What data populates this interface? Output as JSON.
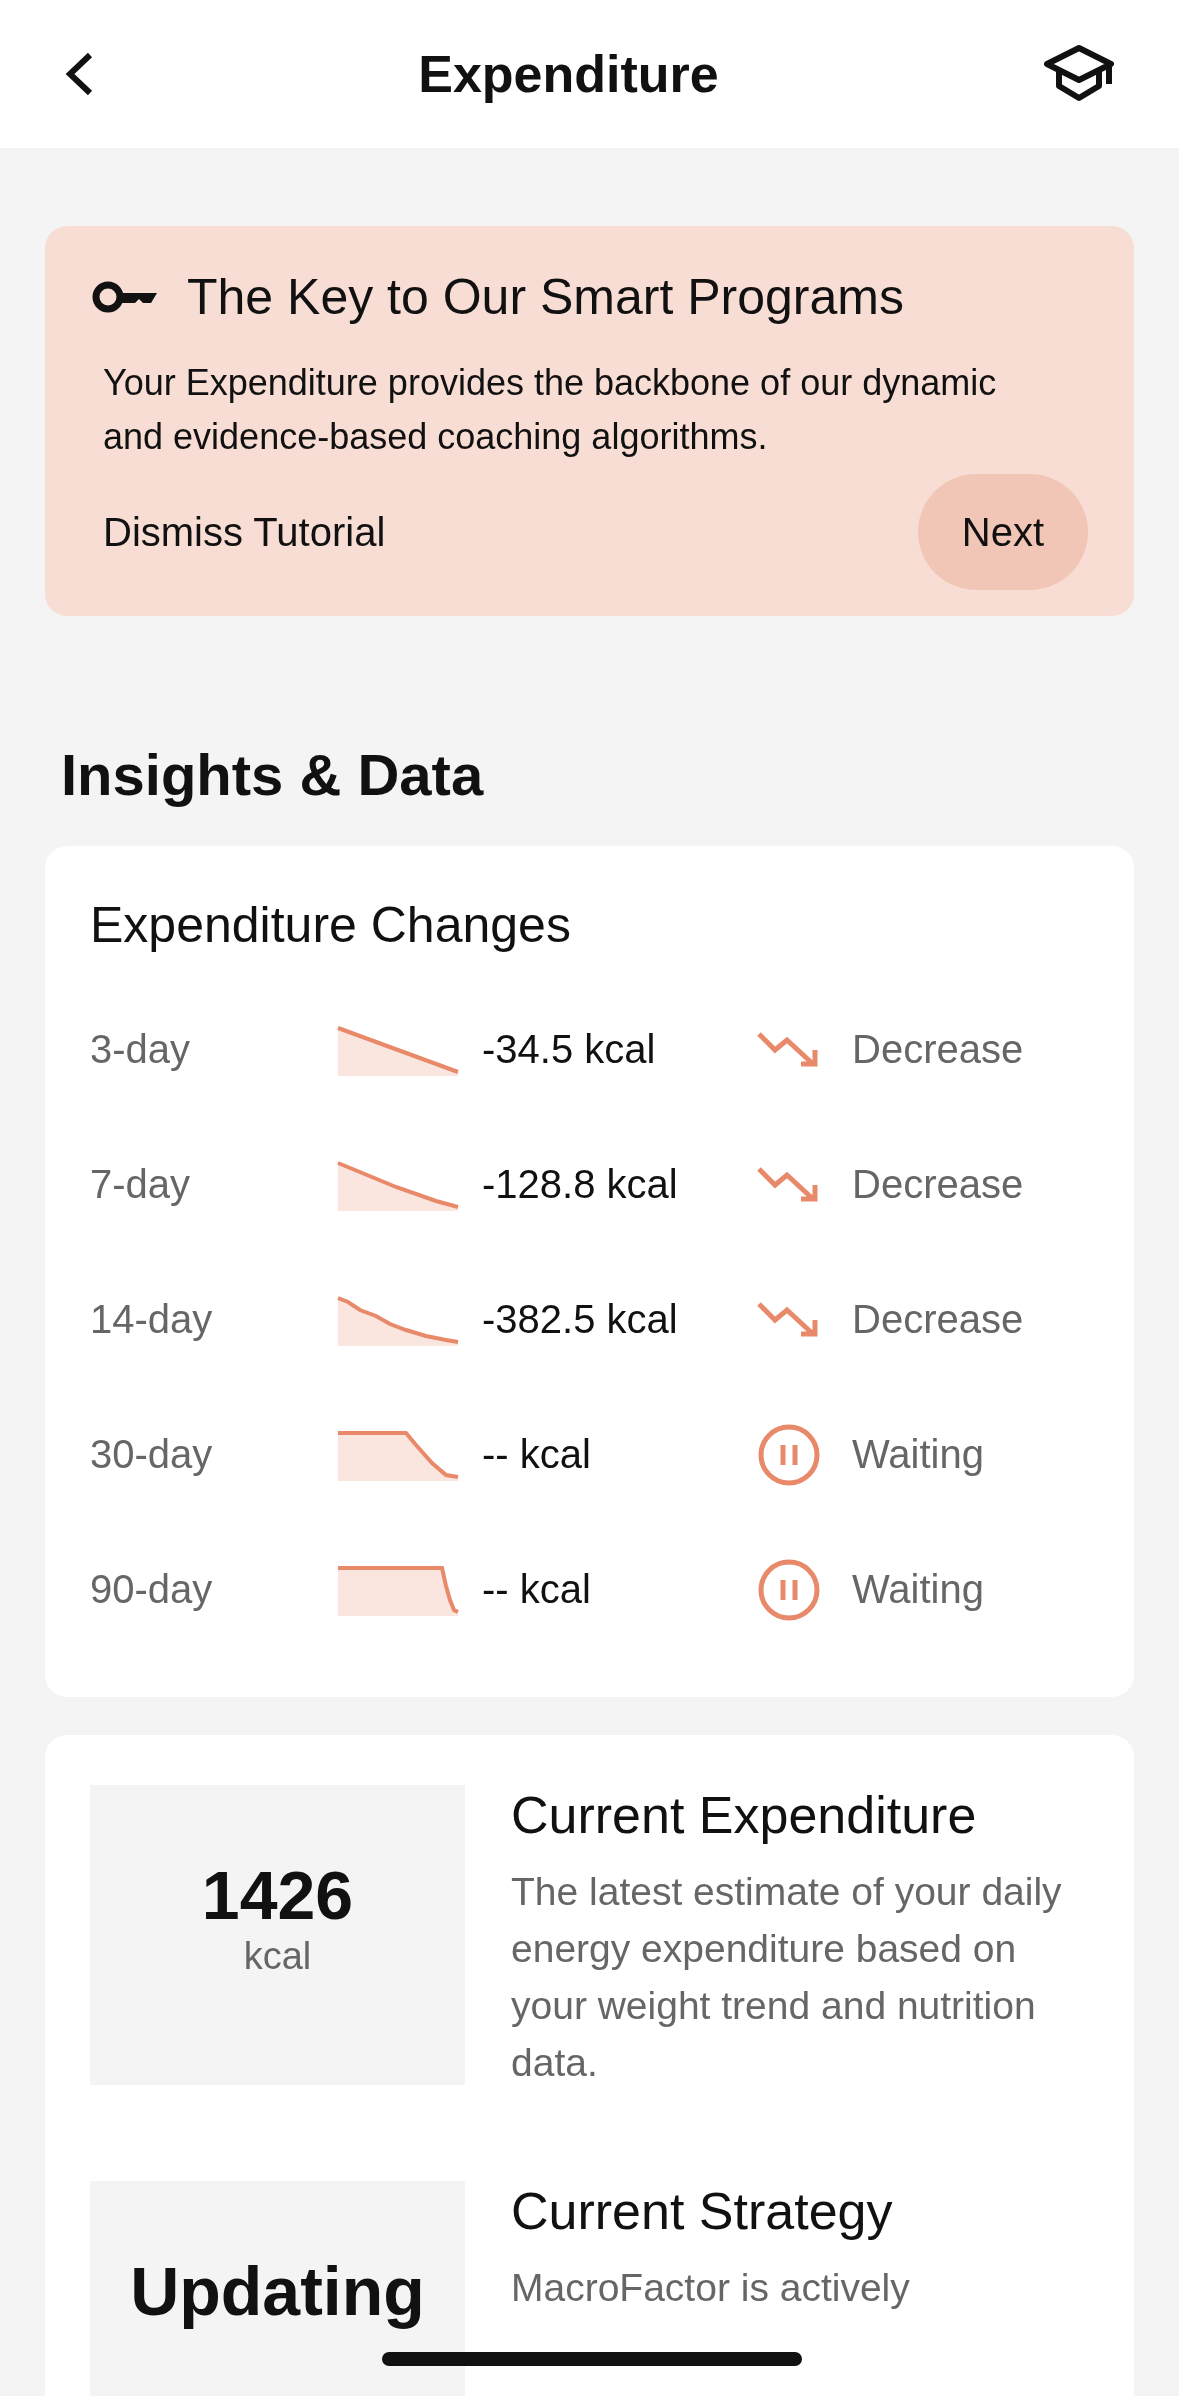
{
  "header": {
    "title": "Expenditure"
  },
  "tutorial": {
    "title": "The Key to Our Smart Programs",
    "body": "Your Expenditure provides the backbone of our dynamic and evidence-based coaching algorithms.",
    "dismiss": "Dismiss Tutorial",
    "next": "Next"
  },
  "section_title": "Insights & Data",
  "changes": {
    "title": "Expenditure Changes",
    "rows": [
      {
        "period": "3-day",
        "value": "-34.5 kcal",
        "status": "Decrease",
        "kind": "decrease"
      },
      {
        "period": "7-day",
        "value": "-128.8 kcal",
        "status": "Decrease",
        "kind": "decrease"
      },
      {
        "period": "14-day",
        "value": "-382.5 kcal",
        "status": "Decrease",
        "kind": "decrease"
      },
      {
        "period": "30-day",
        "value": "-- kcal",
        "status": "Waiting",
        "kind": "waiting"
      },
      {
        "period": "90-day",
        "value": "-- kcal",
        "status": "Waiting",
        "kind": "waiting"
      }
    ]
  },
  "metrics": [
    {
      "value": "1426",
      "unit": "kcal",
      "title": "Current Expenditure",
      "description": "The latest estimate of your daily energy expenditure based on your weight trend and nutrition data."
    },
    {
      "value": "Updating",
      "title": "Current Strategy",
      "description": "MacroFactor is actively"
    }
  ]
}
